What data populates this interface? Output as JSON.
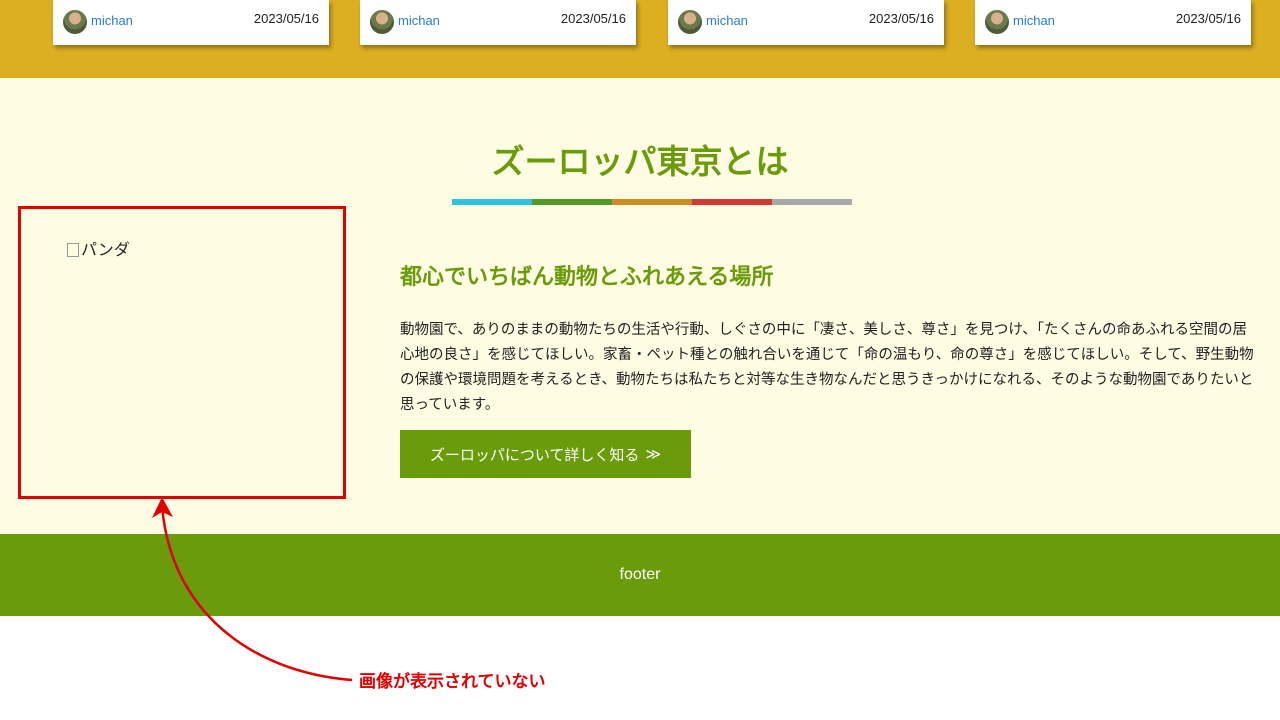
{
  "colors": {
    "top_band": "#dcae22",
    "section_bg": "#fefce3",
    "brand_green": "#6a9b0b",
    "link_blue": "#2a7fc4",
    "annotation_red": "#e00000",
    "title_bar": [
      "#2fc3dc",
      "#4f9a2b",
      "#d08b23",
      "#d23a36",
      "#a8a8a8"
    ]
  },
  "cards": [
    {
      "author": "michan",
      "date": "2023/05/16",
      "avatar_icon": "user-avatar"
    },
    {
      "author": "michan",
      "date": "2023/05/16",
      "avatar_icon": "user-avatar"
    },
    {
      "author": "michan",
      "date": "2023/05/16",
      "avatar_icon": "user-avatar"
    },
    {
      "author": "michan",
      "date": "2023/05/16",
      "avatar_icon": "user-avatar"
    }
  ],
  "about": {
    "title": "ズーロッパ東京とは",
    "image_alt": "パンダ",
    "subtitle": "都心でいちばん動物とふれあえる場所",
    "description": "動物園で、ありのままの動物たちの生活や行動、しぐさの中に「凄さ、美しさ、尊さ」を見つけ、「たくさんの命あふれる空間の居心地の良さ」を感じてほしい。家畜・ペット種との触れ合いを通じて「命の温もり、命の尊さ」を感じてほしい。そして、野生動物の保護や環境問題を考えるとき、動物たちは私たちと対等な生き物なんだと思うきっかけになれる、そのような動物園でありたいと思っています。",
    "button_label": "ズーロッパについて詳しく知る",
    "button_icon": "≫"
  },
  "footer": {
    "text": "footer"
  },
  "annotation": {
    "text": "画像が表示されていない"
  }
}
